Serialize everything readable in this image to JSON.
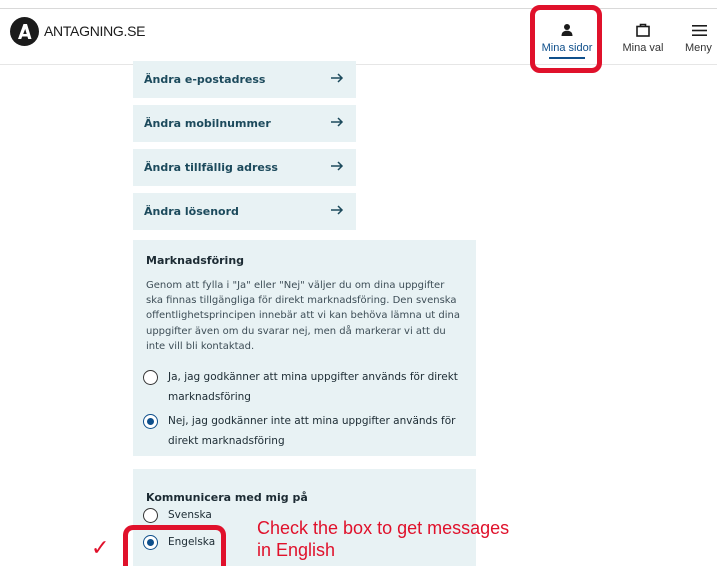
{
  "header": {
    "site_name": "ANTAGNING.SE",
    "nav": [
      {
        "label": "Mina sidor",
        "icon": "person-icon",
        "active": true
      },
      {
        "label": "Mina val",
        "icon": "bag-icon"
      },
      {
        "label": "Meny",
        "icon": "hamburger-menu-icon"
      }
    ]
  },
  "account_links": [
    {
      "label": "Ändra e-postadress"
    },
    {
      "label": "Ändra mobilnummer"
    },
    {
      "label": "Ändra tillfällig adress"
    },
    {
      "label": "Ändra lösenord"
    }
  ],
  "marketing": {
    "title": "Marknadsföring",
    "description_lines": [
      "Genom att fylla i \"Ja\" eller \"Nej\" väljer du om dina uppgifter",
      "ska finnas tillgängliga för direkt marknadsföring. Den svenska",
      "offentlighetsprincipen innebär att vi kan behöva lämna ut dina",
      "uppgifter även om du svarar nej, men då markerar vi att du",
      "inte vill bli kontaktad."
    ],
    "options": [
      {
        "lines": [
          "Ja, jag godkänner att mina uppgifter används för direkt",
          "marknadsföring"
        ],
        "checked": false
      },
      {
        "lines": [
          "Nej, jag godkänner inte att mina uppgifter används för",
          "direkt marknadsföring"
        ],
        "checked": true
      }
    ]
  },
  "communication": {
    "title": "Kommunicera med mig på",
    "options": [
      {
        "label": "Svenska",
        "checked": false
      },
      {
        "label": "Engelska",
        "checked": true
      }
    ]
  },
  "annotation": {
    "lines": [
      "Check the box to get messages",
      "in English"
    ],
    "checkmark": "✓",
    "color": "#e0112b"
  },
  "colors": {
    "panel_bg": "#e8f2f4",
    "accent": "#0e4f8b",
    "highlight": "#e0112b"
  }
}
